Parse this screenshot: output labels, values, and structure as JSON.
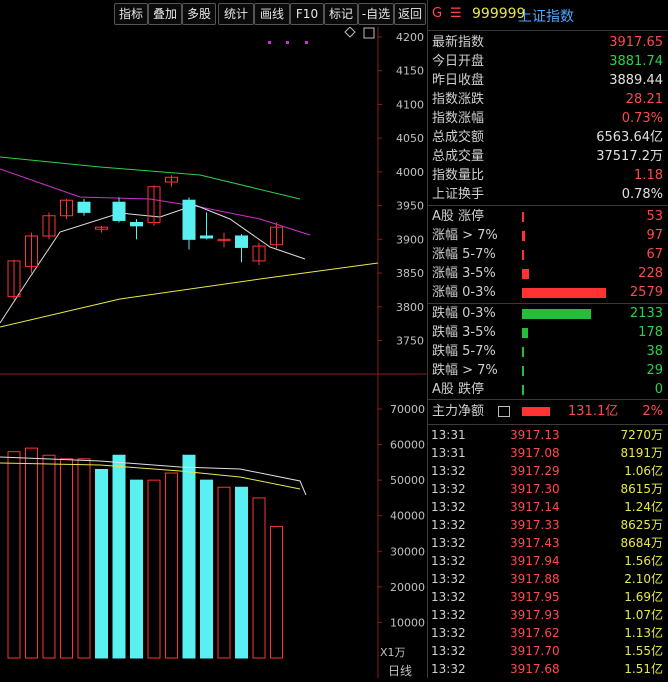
{
  "toolbar": {
    "buttons": [
      "指标",
      "叠加",
      "多股",
      "统计",
      "画线",
      "F10",
      "标记",
      "-自选",
      "返回"
    ]
  },
  "header": {
    "flag": "G",
    "menu_icon": "menu-icon",
    "code": "999999",
    "name": "上证指数"
  },
  "quote": [
    {
      "label": "最新指数",
      "value": "3917.65",
      "color": "red"
    },
    {
      "label": "今日开盘",
      "value": "3881.74",
      "color": "green"
    },
    {
      "label": "昨日收盘",
      "value": "3889.44",
      "color": "white"
    },
    {
      "label": "指数涨跌",
      "value": "28.21",
      "color": "red"
    },
    {
      "label": "指数涨幅",
      "value": "0.73%",
      "color": "red"
    },
    {
      "label": "总成交额",
      "value": "6563.64亿",
      "color": "white"
    },
    {
      "label": "总成交量",
      "value": "37517.2万",
      "color": "white"
    },
    {
      "label": "指数量比",
      "value": "1.18",
      "color": "red"
    },
    {
      "label": "上证换手",
      "value": "0.78%",
      "color": "white"
    }
  ],
  "breadth": [
    {
      "label": "A股 涨停",
      "value": "53",
      "color": "red",
      "level": 0.02
    },
    {
      "label": "涨幅 > 7%",
      "value": "97",
      "color": "red",
      "level": 0.04
    },
    {
      "label": "涨幅 5-7%",
      "value": "67",
      "color": "red",
      "level": 0.026
    },
    {
      "label": "涨幅 3-5%",
      "value": "228",
      "color": "red",
      "level": 0.088
    },
    {
      "label": "涨幅 0-3%",
      "value": "2579",
      "color": "red",
      "level": 1.0
    },
    {
      "label": "跌幅 0-3%",
      "value": "2133",
      "color": "green",
      "level": 0.827
    },
    {
      "label": "跌幅 3-5%",
      "value": "178",
      "color": "green",
      "level": 0.069
    },
    {
      "label": "跌幅 5-7%",
      "value": "38",
      "color": "green",
      "level": 0.015
    },
    {
      "label": "跌幅 > 7%",
      "value": "29",
      "color": "green",
      "level": 0.011
    },
    {
      "label": "A股 跌停",
      "value": "0",
      "color": "green",
      "level": 0.0
    }
  ],
  "net_flow": {
    "label": "主力净额",
    "amount": "131.1亿",
    "pct": "2%",
    "icon": "table-icon"
  },
  "ticks": [
    {
      "time": "13:31",
      "price": "3917.13",
      "vol": "7270万"
    },
    {
      "time": "13:31",
      "price": "3917.08",
      "vol": "8191万"
    },
    {
      "time": "13:32",
      "price": "3917.29",
      "vol": "1.06亿"
    },
    {
      "time": "13:32",
      "price": "3917.30",
      "vol": "8615万"
    },
    {
      "time": "13:32",
      "price": "3917.14",
      "vol": "1.24亿"
    },
    {
      "time": "13:32",
      "price": "3917.33",
      "vol": "8625万"
    },
    {
      "time": "13:32",
      "price": "3917.43",
      "vol": "8684万"
    },
    {
      "time": "13:32",
      "price": "3917.94",
      "vol": "1.56亿"
    },
    {
      "time": "13:32",
      "price": "3917.88",
      "vol": "2.10亿"
    },
    {
      "time": "13:32",
      "price": "3917.95",
      "vol": "1.69亿"
    },
    {
      "time": "13:32",
      "price": "3917.93",
      "vol": "1.07亿"
    },
    {
      "time": "13:32",
      "price": "3917.62",
      "vol": "1.13亿"
    },
    {
      "time": "13:32",
      "price": "3917.70",
      "vol": "1.55亿"
    },
    {
      "time": "13:32",
      "price": "3917.68",
      "vol": "1.51亿"
    }
  ],
  "chart": {
    "price_axis": [
      "4200",
      "4150",
      "4100",
      "4050",
      "4000",
      "3950",
      "3900",
      "3850",
      "3800",
      "3750"
    ],
    "volume_axis": [
      "70000",
      "60000",
      "50000",
      "40000",
      "30000",
      "20000",
      "10000"
    ],
    "volume_unit": "X1万",
    "period": "日线",
    "candles": [
      {
        "o": 3815,
        "h": 3870,
        "l": 3810,
        "c": 3868
      },
      {
        "o": 3860,
        "h": 3910,
        "l": 3850,
        "c": 3905
      },
      {
        "o": 3905,
        "h": 3940,
        "l": 3900,
        "c": 3935
      },
      {
        "o": 3935,
        "h": 3960,
        "l": 3930,
        "c": 3958
      },
      {
        "o": 3955,
        "h": 3960,
        "l": 3935,
        "c": 3940
      },
      {
        "o": 3915,
        "h": 3920,
        "l": 3910,
        "c": 3918
      },
      {
        "o": 3955,
        "h": 3962,
        "l": 3925,
        "c": 3928
      },
      {
        "o": 3925,
        "h": 3930,
        "l": 3900,
        "c": 3920
      },
      {
        "o": 3925,
        "h": 3980,
        "l": 3920,
        "c": 3978
      },
      {
        "o": 3985,
        "h": 3995,
        "l": 3978,
        "c": 3992
      },
      {
        "o": 3958,
        "h": 3962,
        "l": 3885,
        "c": 3900
      },
      {
        "o": 3905,
        "h": 3940,
        "l": 3900,
        "c": 3902
      },
      {
        "o": 3898,
        "h": 3910,
        "l": 3888,
        "c": 3900
      },
      {
        "o": 3905,
        "h": 3908,
        "l": 3866,
        "c": 3888
      },
      {
        "o": 3868,
        "h": 3895,
        "l": 3862,
        "c": 3890
      },
      {
        "o": 3892,
        "h": 3925,
        "l": 3886,
        "c": 3918
      }
    ],
    "volumes": [
      58000,
      59000,
      57000,
      56000,
      56000,
      53000,
      57000,
      50000,
      50000,
      52000,
      57000,
      50000,
      48000,
      48000,
      45000,
      37000
    ],
    "vol_colors": [
      "red",
      "red",
      "red",
      "red",
      "red",
      "cyan",
      "cyan",
      "cyan",
      "red",
      "red",
      "cyan",
      "cyan",
      "red",
      "cyan",
      "red",
      "red"
    ]
  }
}
